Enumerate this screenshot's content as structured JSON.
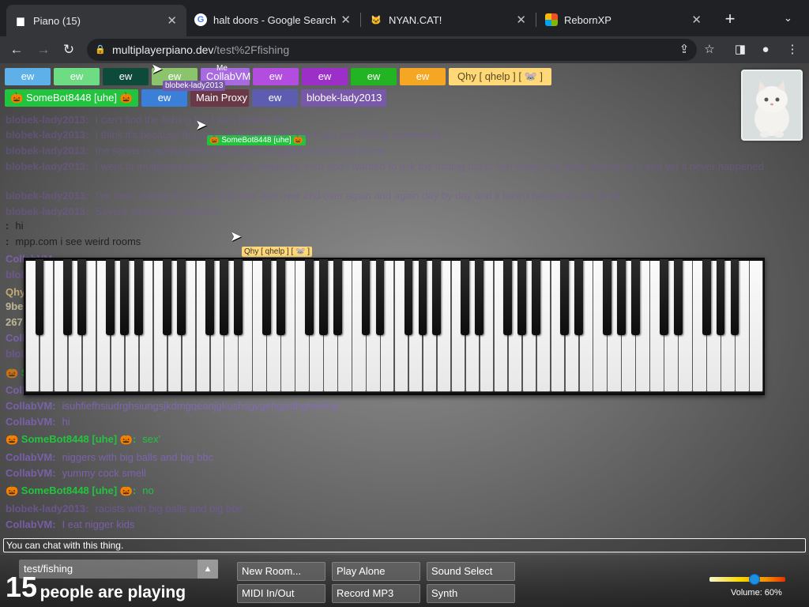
{
  "browser": {
    "tabs": [
      {
        "title": "Piano (15)",
        "favicon": "piano-favicon-icon"
      },
      {
        "title": "halt doors - Google Search",
        "favicon": "google-favicon-icon"
      },
      {
        "title": "NYAN.CAT!",
        "favicon": "nyan-cat-favicon-icon"
      },
      {
        "title": "RebornXP",
        "favicon": "rebornxp-favicon-icon"
      }
    ],
    "close_glyph": "✕",
    "new_tab_glyph": "+",
    "url_host": "multiplayerpiano.dev",
    "url_path": "/test%2Ffishing"
  },
  "participants": {
    "row1": [
      {
        "name": "ew",
        "color": "#5db1e8"
      },
      {
        "name": "ew",
        "color": "#6edc82"
      },
      {
        "name": "ew",
        "color": "#0d4a3a"
      },
      {
        "name": "ew",
        "color": "#8cc46e"
      },
      {
        "name": "CollabVM",
        "color": "#a86ae0"
      },
      {
        "name": "ew",
        "color": "#b24de0"
      },
      {
        "name": "ew",
        "color": "#9c2fc8"
      },
      {
        "name": "ew",
        "color": "#22b422"
      },
      {
        "name": "ew",
        "color": "#f5a623"
      },
      {
        "name": "Qhy [ qhelp ] [ 🐭 ]",
        "color": "#ffd878"
      }
    ],
    "row2": [
      {
        "name": "🎃 SomeBot8448 [uhe] 🎃",
        "color": "#22c43e"
      },
      {
        "name": "ew",
        "color": "#3a7fd8"
      },
      {
        "name": "Main Proxy",
        "color": "#6b3848"
      },
      {
        "name": "ew",
        "color": "#5c5cb0"
      },
      {
        "name": "blobek-lady2013",
        "color": "#7858a8"
      }
    ],
    "me_label": "Me"
  },
  "cursor_tags": [
    {
      "name": "blobek-lady2013",
      "color": "#7858a8"
    },
    {
      "name": "🎃 SomeBot8448 [uhe] 🎃",
      "color": "#22c43e"
    },
    {
      "name": "Qhy [ qhelp ] [ 🐭 ]",
      "color": "#ffd878"
    }
  ],
  "chat_top": [
    {
      "name": "blobek-lady2013:",
      "text": "I can't find the fishing bot I was looking for",
      "name_color": "#7858a8",
      "text_color": "#7858a8"
    },
    {
      "name": "blobek-lady2013:",
      "text": "I think it's because the room is broken and I can't use any fishing commands",
      "name_color": "#7858a8",
      "text_color": "#7858a8"
    },
    {
      "name": "blobek-lady2013:",
      "text": "the server is acting weird and the bot stopped responding to me",
      "name_color": "#7858a8",
      "text_color": "#7858a8"
    },
    {
      "name": "blobek-lady2013:",
      "text": "I went to multiplayerpiano.com and mppclone.com and I wanted to ask the fishing bot to fish today. I've been asking for it and yet it never happened",
      "name_color": "#7858a8",
      "text_color": "#7858a8"
    },
    {
      "name": "blobek-lady2013:",
      "text": "I've been asking for it over and over and over and over again and again day by day and it hasn't happened yet at all",
      "name_color": "#7858a8",
      "text_color": "#7858a8"
    },
    {
      "name": "blobek-lady2013:",
      "text": "Severe stress and sadness",
      "name_color": "#7858a8",
      "text_color": "#7858a8"
    },
    {
      "name": ":",
      "text": "hi",
      "name_color": "#222222",
      "text_color": "#222222"
    },
    {
      "name": ":",
      "text": "mpp.com i see weird rooms",
      "name_color": "#222222",
      "text_color": "#222222"
    }
  ],
  "chat_side": [
    {
      "text": "CollabVM",
      "color": "#8a66d0"
    },
    {
      "text": "blobe",
      "color": "#7858a8"
    },
    {
      "text": "Qhy",
      "color": "#f0d080"
    },
    {
      "text": "9be",
      "color": "#e8e0b0"
    },
    {
      "text": "267",
      "color": "#e8e0b0"
    },
    {
      "text": "Colla",
      "color": "#8a66d0"
    },
    {
      "text": "blobe",
      "color": "#7858a8"
    },
    {
      "text": "🎃 S",
      "color": "#22c43e"
    },
    {
      "text": "Colla",
      "color": "#8a66d0"
    }
  ],
  "chat_bottom": [
    {
      "name": "CollabVM:",
      "text": "isuhfiefhsiudrghsiungsjkdmgqeanjgkushsgvgehgjsdhgheiohg",
      "name_color": "#8a66d0",
      "text_color": "#8a66d0"
    },
    {
      "name": "CollabVM:",
      "text": "hi",
      "name_color": "#8a66d0",
      "text_color": "#8a66d0"
    },
    {
      "name": "🎃 SomeBot8448 [uhe] 🎃:",
      "text": "sex'",
      "name_color": "#22c43e",
      "text_color": "#22c43e"
    },
    {
      "name": "CollabVM:",
      "text": "niggers with big balls and big bbc",
      "name_color": "#8a66d0",
      "text_color": "#8a66d0"
    },
    {
      "name": "CollabVM:",
      "text": "yummy cock smell",
      "name_color": "#8a66d0",
      "text_color": "#8a66d0"
    },
    {
      "name": "🎃 SomeBot8448 [uhe] 🎃:",
      "text": "no",
      "name_color": "#22c43e",
      "text_color": "#22c43e"
    },
    {
      "name": "blobek-lady2013:",
      "text": "racists with big balls and big bbc",
      "name_color": "#7858a8",
      "text_color": "#7858a8"
    },
    {
      "name": "CollabVM:",
      "text": "I eat nigger kids",
      "name_color": "#8a66d0",
      "text_color": "#8a66d0"
    }
  ],
  "chat_input_placeholder": "You can chat with this thing.",
  "room": {
    "name": "test/fishing",
    "arrow": "▲"
  },
  "players": {
    "count": "15",
    "label": "people are playing"
  },
  "buttons": {
    "new_room": "New Room...",
    "play_alone": "Play Alone",
    "sound_select": "Sound Select",
    "midi": "MIDI In/Out",
    "record": "Record MP3",
    "synth": "Synth"
  },
  "volume": {
    "label": "Volume: 60%",
    "level": 0.6
  },
  "piano": {
    "white_keys": 52
  }
}
